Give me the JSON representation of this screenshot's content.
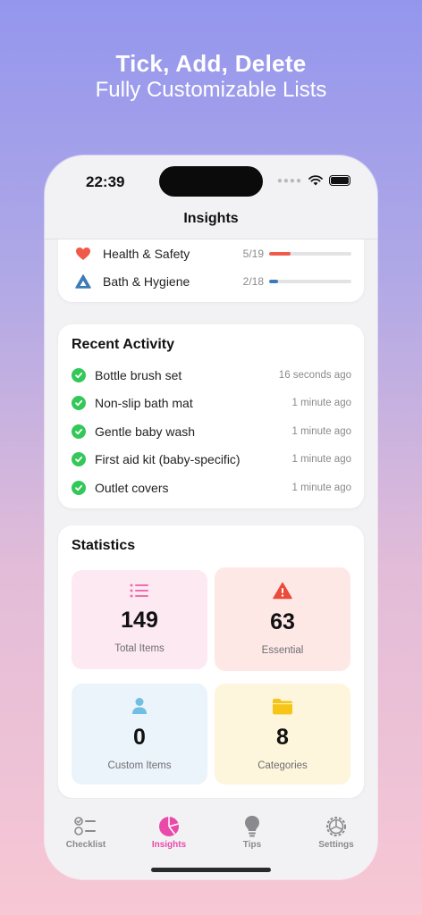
{
  "headline": {
    "line1": "Tick, Add, Delete",
    "line2": "Fully Customizable Lists"
  },
  "status_bar": {
    "time": "22:39"
  },
  "nav": {
    "title": "Insights"
  },
  "categories": [
    {
      "name": "Health & Safety",
      "count": "5/19",
      "progress": 0.263,
      "color": "#f05a4a",
      "icon": "heart-icon"
    },
    {
      "name": "Bath & Hygiene",
      "count": "2/18",
      "progress": 0.111,
      "color": "#3b7bb8",
      "icon": "drop-icon"
    }
  ],
  "recent_activity": {
    "title": "Recent Activity",
    "items": [
      {
        "name": "Bottle brush set",
        "time": "16 seconds ago"
      },
      {
        "name": "Non-slip bath mat",
        "time": "1 minute ago"
      },
      {
        "name": "Gentle baby wash",
        "time": "1 minute ago"
      },
      {
        "name": "First aid kit (baby-specific)",
        "time": "1 minute ago"
      },
      {
        "name": "Outlet covers",
        "time": "1 minute ago"
      }
    ]
  },
  "statistics": {
    "title": "Statistics",
    "tiles": [
      {
        "value": "149",
        "label": "Total Items",
        "icon": "list-icon",
        "color": "#ee6fb0",
        "bg": "#fde9f1"
      },
      {
        "value": "63",
        "label": "Essential",
        "icon": "warning-icon",
        "color": "#ea4b3c",
        "bg": "#fde8e6"
      },
      {
        "value": "0",
        "label": "Custom Items",
        "icon": "person-icon",
        "color": "#6fbfe3",
        "bg": "#eaf4fa"
      },
      {
        "value": "8",
        "label": "Categories",
        "icon": "folder-icon",
        "color": "#f5c518",
        "bg": "#fdf6dc"
      }
    ]
  },
  "tabs": [
    {
      "label": "Checklist",
      "icon": "checklist-icon",
      "active": false
    },
    {
      "label": "Insights",
      "icon": "pie-chart-icon",
      "active": true
    },
    {
      "label": "Tips",
      "icon": "lightbulb-icon",
      "active": false
    },
    {
      "label": "Settings",
      "icon": "gear-icon",
      "active": false
    }
  ]
}
